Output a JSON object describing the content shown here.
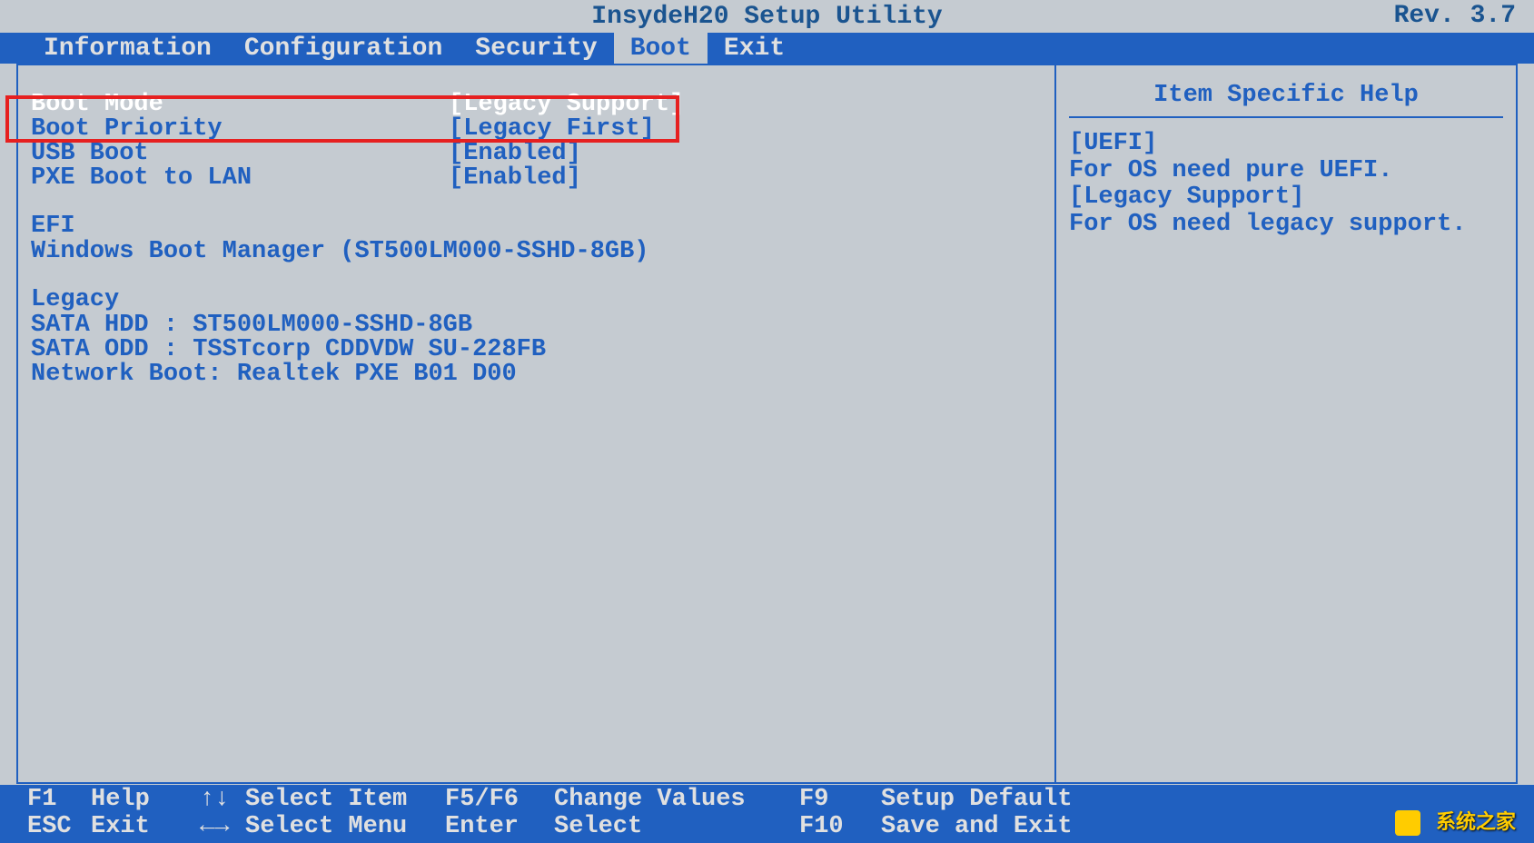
{
  "header": {
    "title": "InsydeH20 Setup Utility",
    "revision": "Rev. 3.7"
  },
  "tabs": [
    {
      "label": "Information"
    },
    {
      "label": "Configuration"
    },
    {
      "label": "Security"
    },
    {
      "label": "Boot",
      "active": true
    },
    {
      "label": "Exit"
    }
  ],
  "settings": [
    {
      "label": "Boot Mode",
      "value": "[Legacy Support]",
      "selected": true
    },
    {
      "label": "Boot Priority",
      "value": "[Legacy First]"
    },
    {
      "label": "USB Boot",
      "value": "[Enabled]"
    },
    {
      "label": "PXE Boot to LAN",
      "value": "[Enabled]"
    }
  ],
  "efi_section": {
    "header": "EFI",
    "items": [
      "Windows Boot Manager (ST500LM000-SSHD-8GB)"
    ]
  },
  "legacy_section": {
    "header": "Legacy",
    "items": [
      "SATA HDD    :  ST500LM000-SSHD-8GB",
      "SATA ODD    :  TSSTcorp CDDVDW SU-228FB",
      "Network Boot:  Realtek PXE B01 D00"
    ]
  },
  "help_panel": {
    "title": "Item Specific Help",
    "lines": [
      "[UEFI]",
      "For OS need pure UEFI.",
      "[Legacy Support]",
      "For OS need legacy support."
    ]
  },
  "footer": {
    "row1": {
      "k1": "F1",
      "d1": "Help",
      "a1": "↑↓",
      "t1": "Select Item",
      "k2": "F5/F6",
      "t2": "Change Values",
      "k3": "F9",
      "t3": "Setup Default"
    },
    "row2": {
      "k1": "ESC",
      "d1": "Exit",
      "a1": "←→",
      "t1": "Select Menu",
      "k2": "Enter",
      "t2": "Select",
      "k3": "F10",
      "t3": "Save and Exit"
    }
  },
  "watermark": "系统之家"
}
